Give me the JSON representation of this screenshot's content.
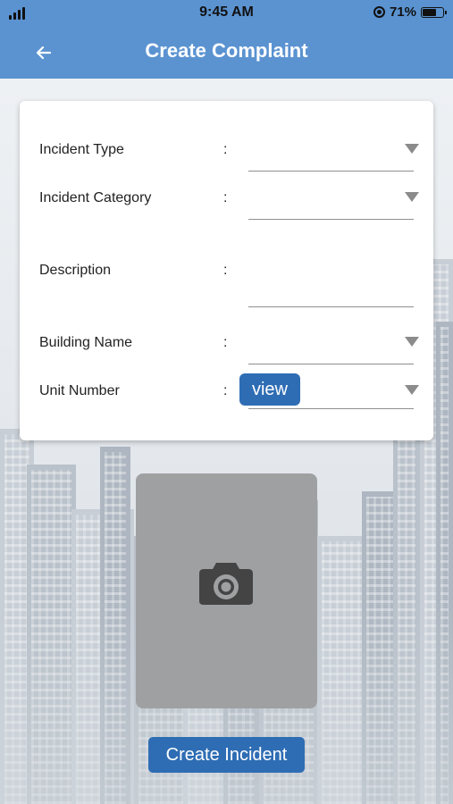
{
  "status_bar": {
    "time": "9:45 AM",
    "battery_percent": "71%",
    "battery_level": 0.71
  },
  "app_bar": {
    "title": "Create Complaint",
    "back_icon": "arrow-left-icon"
  },
  "form": {
    "colon": ":",
    "fields": [
      {
        "label": "Incident Type",
        "value": "",
        "type": "dropdown"
      },
      {
        "label": "Incident Category",
        "value": "",
        "type": "dropdown"
      },
      {
        "label": "Description",
        "value": "",
        "type": "text"
      },
      {
        "label": "Building Name",
        "value": "",
        "type": "dropdown"
      },
      {
        "label": "Unit Number",
        "value": "",
        "type": "dropdown"
      }
    ],
    "view_button": "view"
  },
  "photo": {
    "icon": "camera-icon"
  },
  "submit_button": "Create Incident",
  "colors": {
    "primary": "#5b93d1",
    "button": "#2e6db4",
    "photo_bg": "#9fa0a1"
  }
}
